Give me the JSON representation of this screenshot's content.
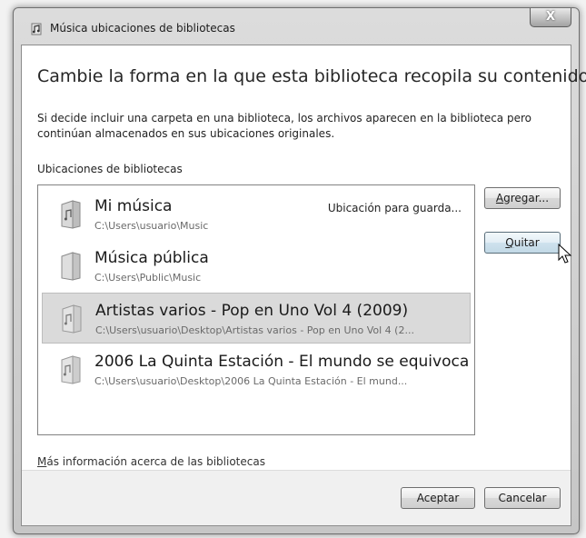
{
  "window": {
    "title": "Música ubicaciones de bibliotecas",
    "close_label": "X"
  },
  "main": {
    "headline": "Cambie la forma en la que esta biblioteca recopila su contenido",
    "description": "Si decide incluir una carpeta en una biblioteca, los archivos aparecen en la biblioteca pero continúan almacenados en sus ubicaciones originales.",
    "locations_label": "Ubicaciones de bibliotecas",
    "locations": [
      {
        "name": "Mi música",
        "path": "C:\\Users\\usuario\\Music",
        "status": "Ubicación para guarda...",
        "icon": "music-folder-icon",
        "selected": false
      },
      {
        "name": "Música pública",
        "path": "C:\\Users\\Public\\Music",
        "status": "",
        "icon": "folder-icon",
        "selected": false
      },
      {
        "name": "Artistas varios - Pop en Uno Vol 4 (2009)",
        "path": "C:\\Users\\usuario\\Desktop\\Artistas varios - Pop en Uno Vol 4 (2...",
        "status": "",
        "icon": "music-folder-icon",
        "selected": true
      },
      {
        "name": "2006 La Quinta Estación -  El mundo se equivoca",
        "path": "C:\\Users\\usuario\\Desktop\\2006 La Quinta Estación -  El mund...",
        "status": "",
        "icon": "music-folder-icon",
        "selected": false
      }
    ],
    "add_button": {
      "first": "A",
      "rest": "gregar..."
    },
    "remove_button": {
      "first": "Q",
      "rest": "uitar"
    },
    "more_info_link": {
      "first": "M",
      "rest": "ás información acerca de las bibliotecas"
    }
  },
  "footer": {
    "ok_label": "Aceptar",
    "cancel_label": "Cancelar"
  }
}
